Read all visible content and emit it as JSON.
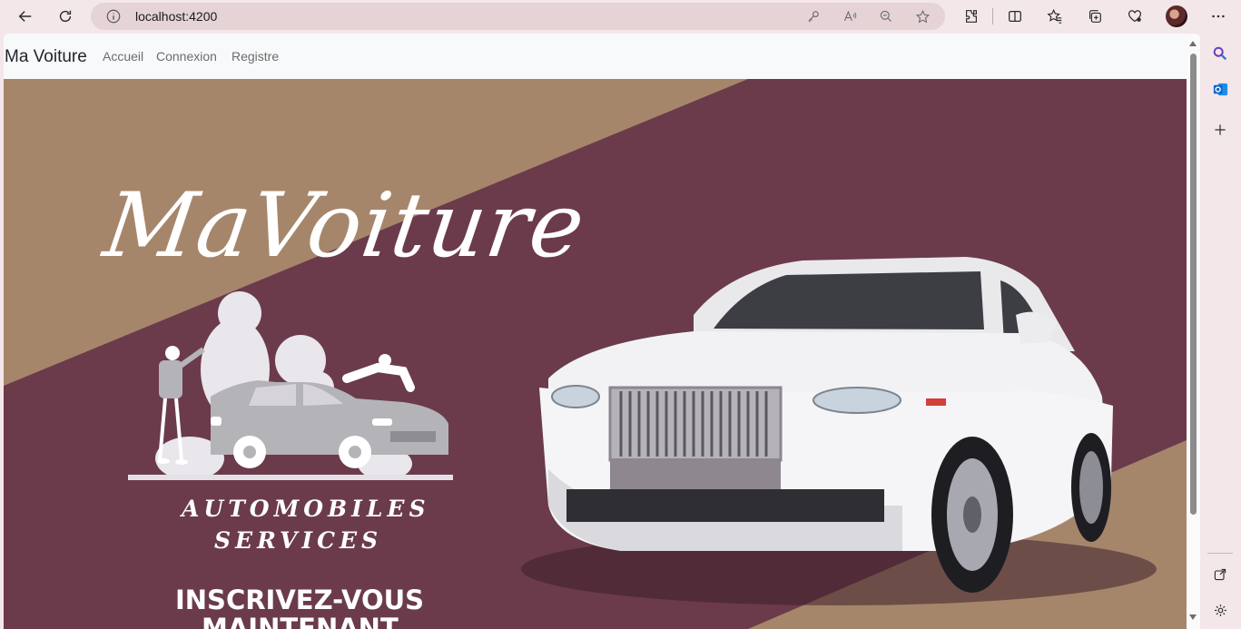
{
  "browser": {
    "url": "localhost:4200",
    "toolbar_icons": [
      "back-icon",
      "refresh-icon",
      "info-icon",
      "key-icon",
      "read-aloud-icon",
      "zoom-out-icon",
      "favorite-star-icon",
      "extensions-icon",
      "split-screen-icon",
      "favorites-icon",
      "collections-icon",
      "copilot-icon",
      "profile-avatar",
      "more-icon"
    ],
    "sidebar_icons": [
      "search-icon",
      "outlook-icon",
      "add-icon",
      "open-external-icon",
      "settings-icon"
    ]
  },
  "page": {
    "brand": "Ma Voiture",
    "nav": [
      {
        "label": "Accueil"
      },
      {
        "label": "Connexion"
      },
      {
        "label": "Registre"
      }
    ],
    "hero": {
      "script_title": "MaVoiture",
      "services_line1": "AUTOMOBILES",
      "services_line2": "SERVICES",
      "cta_line1": "INSCRIVEZ-VOUS",
      "cta_line2": "MAINTENANT"
    }
  },
  "colors": {
    "tan": "#a6866b",
    "plum": "#6b3b4b",
    "white": "#ffffff",
    "illustration_gray": "#b3b3b8"
  }
}
